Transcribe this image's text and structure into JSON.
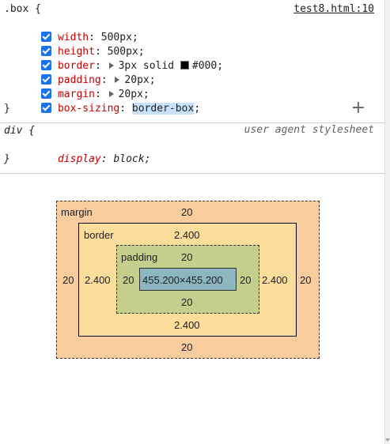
{
  "rule": {
    "selector": ".box {",
    "source": "test8.html:10",
    "close": "}",
    "declarations": [
      {
        "name": "width",
        "colon": ": ",
        "value": "500px",
        "semi": ";"
      },
      {
        "name": "height",
        "colon": ": ",
        "value": "500px",
        "semi": ";"
      },
      {
        "name": "border",
        "colon": ": ",
        "value_a": "3px solid ",
        "value_b": "#000",
        "semi": ";"
      },
      {
        "name": "padding",
        "colon": ": ",
        "value": "20px",
        "semi": ";"
      },
      {
        "name": "margin",
        "colon": ": ",
        "value": "20px",
        "semi": ";"
      },
      {
        "name": "box-sizing",
        "colon": ": ",
        "value": "border-box",
        "semi": ";"
      }
    ],
    "add_label": "+"
  },
  "ua_rule": {
    "selector": "div {",
    "source": "user agent stylesheet",
    "prop": "display",
    "colon": ": ",
    "value": "block",
    "semi": ";",
    "close": "}"
  },
  "box_model": {
    "margin": {
      "label": "margin",
      "top": "20",
      "bottom": "20",
      "left": "20",
      "right": "20"
    },
    "border": {
      "label": "border",
      "top": "2.400",
      "bottom": "2.400",
      "left": "2.400",
      "right": "2.400"
    },
    "padding": {
      "label": "padding",
      "top": "20",
      "bottom": "20",
      "left": "20",
      "right": "20"
    },
    "content": "455.200×455.200"
  },
  "colors": {
    "margin": "#f9cc9d",
    "border": "#fcdd9b",
    "padding": "#c3d08b",
    "content": "#8cb6c0",
    "checkbox": "#1a73e8",
    "property": "#c80000"
  }
}
